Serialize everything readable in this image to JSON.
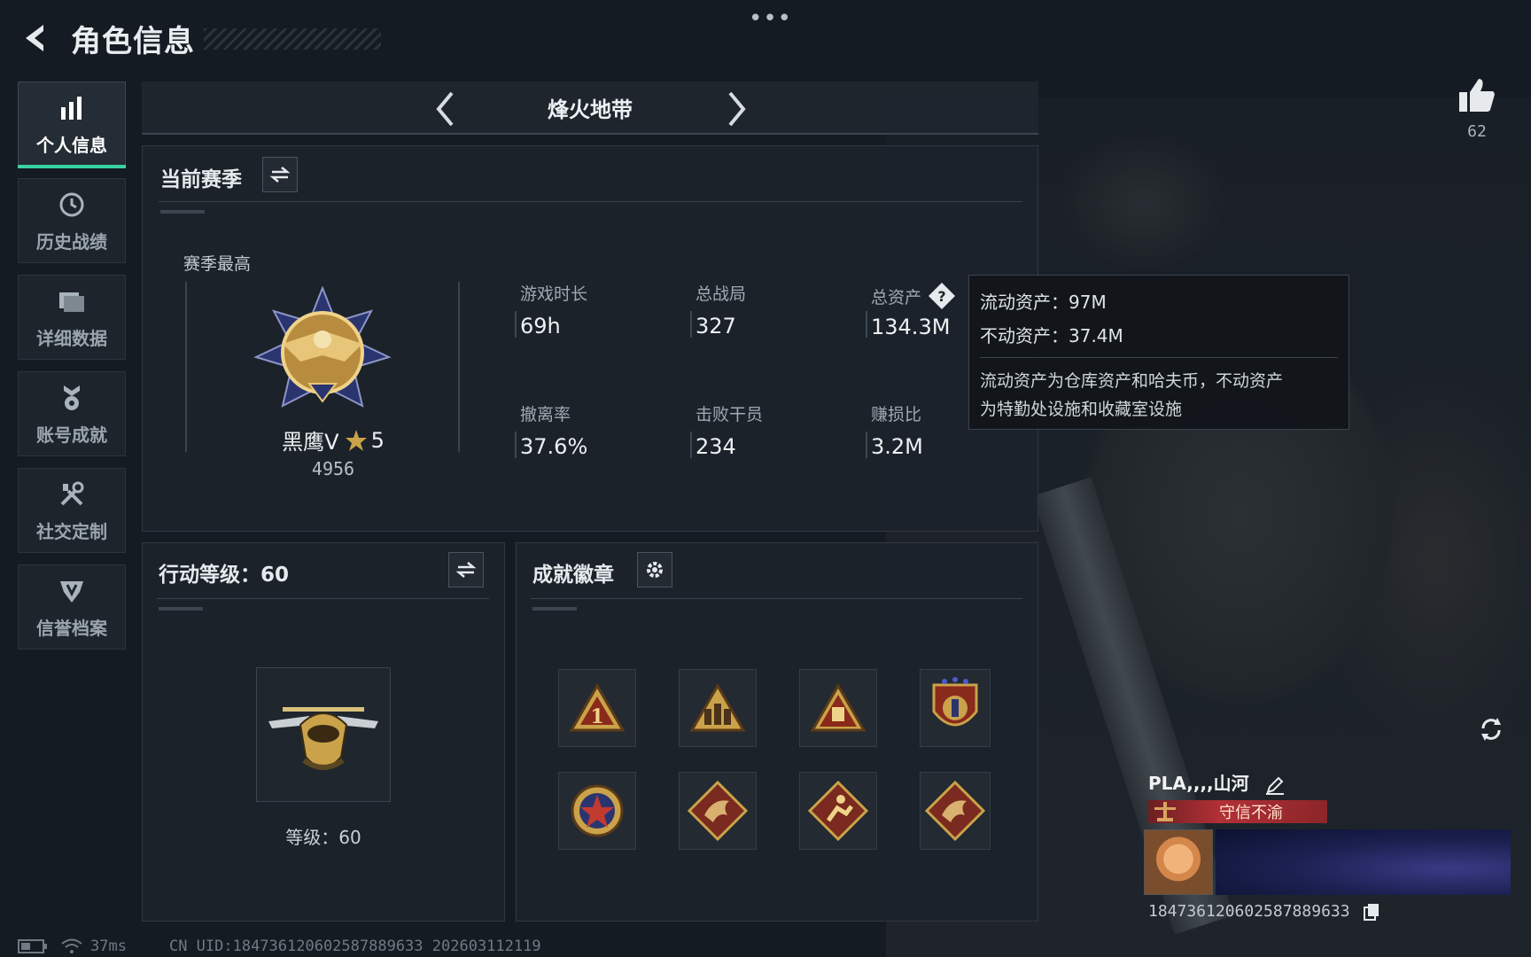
{
  "header": {
    "title": "角色信息"
  },
  "sidebar": {
    "items": [
      {
        "label": "个人信息",
        "icon": "bar-chart-icon",
        "active": true
      },
      {
        "label": "历史战绩",
        "icon": "history-clock-icon",
        "active": false
      },
      {
        "label": "详细数据",
        "icon": "folder-icon",
        "active": false
      },
      {
        "label": "账号成就",
        "icon": "medal-icon",
        "active": false
      },
      {
        "label": "社交定制",
        "icon": "tools-icon",
        "active": false
      },
      {
        "label": "信誉档案",
        "icon": "shield-icon",
        "active": false
      }
    ]
  },
  "map_selector": {
    "name": "烽火地带"
  },
  "season": {
    "title": "当前赛季",
    "best_label": "赛季最高",
    "rank_name": "黑鹰V",
    "rank_stars": "5",
    "rank_score": "4956",
    "stats": [
      {
        "label": "游戏时长",
        "value": "69h"
      },
      {
        "label": "总战局",
        "value": "327"
      },
      {
        "label": "总资产",
        "value": "134.3M"
      },
      {
        "label": "撤离率",
        "value": "37.6%"
      },
      {
        "label": "击败干员",
        "value": "234"
      },
      {
        "label": "赚损比",
        "value": "3.2M"
      }
    ]
  },
  "tooltip": {
    "liquid": "流动资产：97M",
    "fixed": "不动资产：37.4M",
    "desc_line1": "流动资产为仓库资产和哈夫币，不动资产",
    "desc_line2": "为特勤处设施和收藏室设施"
  },
  "action_level": {
    "title": "行动等级：60",
    "level_text": "等级：60"
  },
  "badges": {
    "title": "成就徽章",
    "items": [
      "rank-1-triangle-badge",
      "squad-triangle-badge",
      "supply-triangle-badge",
      "star-shield-badge",
      "star-roundel-badge",
      "dragon-diamond-badge",
      "runner-diamond-badge",
      "dragon-diamond-badge-2"
    ]
  },
  "likes": {
    "count": "62"
  },
  "profile": {
    "name": "PLA,,,,山河",
    "title_strip": "守信不渝",
    "uid": "1847361206025878896​33"
  },
  "footer": {
    "ping": "37ms",
    "uid_line": "CN UID:184736120602587889633 202603112119"
  },
  "colors": {
    "accent": "#37d2a2",
    "title_red": "#b23036",
    "gold": "#c9a24a"
  }
}
